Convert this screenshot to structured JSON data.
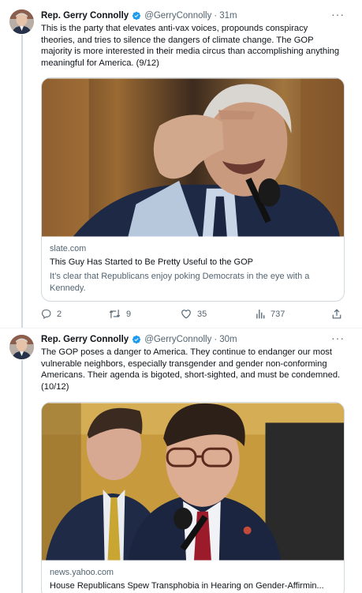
{
  "tweets": [
    {
      "author_name": "Rep. Gerry Connolly",
      "handle": "@GerryConnolly",
      "separator": "·",
      "time": "31m",
      "text": "This is the party that elevates anti-vax voices, propounds conspiracy theories, and tries to silence the dangers of climate change. The GOP majority is more interested in their media circus than accomplishing anything meaningful for America. (9/12)",
      "card": {
        "domain": "slate.com",
        "title": "This Guy Has Started to Be Pretty Useful to the GOP",
        "description": "It’s clear that Republicans enjoy poking Democrats in the eye with a Kennedy."
      },
      "stats": {
        "replies": "2",
        "retweets": "9",
        "likes": "35",
        "views": "737"
      }
    },
    {
      "author_name": "Rep. Gerry Connolly",
      "handle": "@GerryConnolly",
      "separator": "·",
      "time": "30m",
      "text": "The GOP poses a danger to America. They continue to endanger our most vulnerable neighbors, especially transgender and gender non-conforming Americans. Their agenda is bigoted, short-sighted, and must be condemned. (10/12)",
      "card": {
        "domain": "news.yahoo.com",
        "title": "House Republicans Spew Transphobia in Hearing on Gender-Affirmin..."
      }
    }
  ],
  "icons": {
    "verified": "verified-badge-icon",
    "more": "more-horizontal-icon",
    "reply": "reply-icon",
    "retweet": "retweet-icon",
    "like": "heart-icon",
    "views": "analytics-icon",
    "share": "share-icon"
  },
  "colors": {
    "text": "#0f1419",
    "secondary": "#536471",
    "border": "#cfd9de",
    "verified": "#1d9bf0"
  }
}
